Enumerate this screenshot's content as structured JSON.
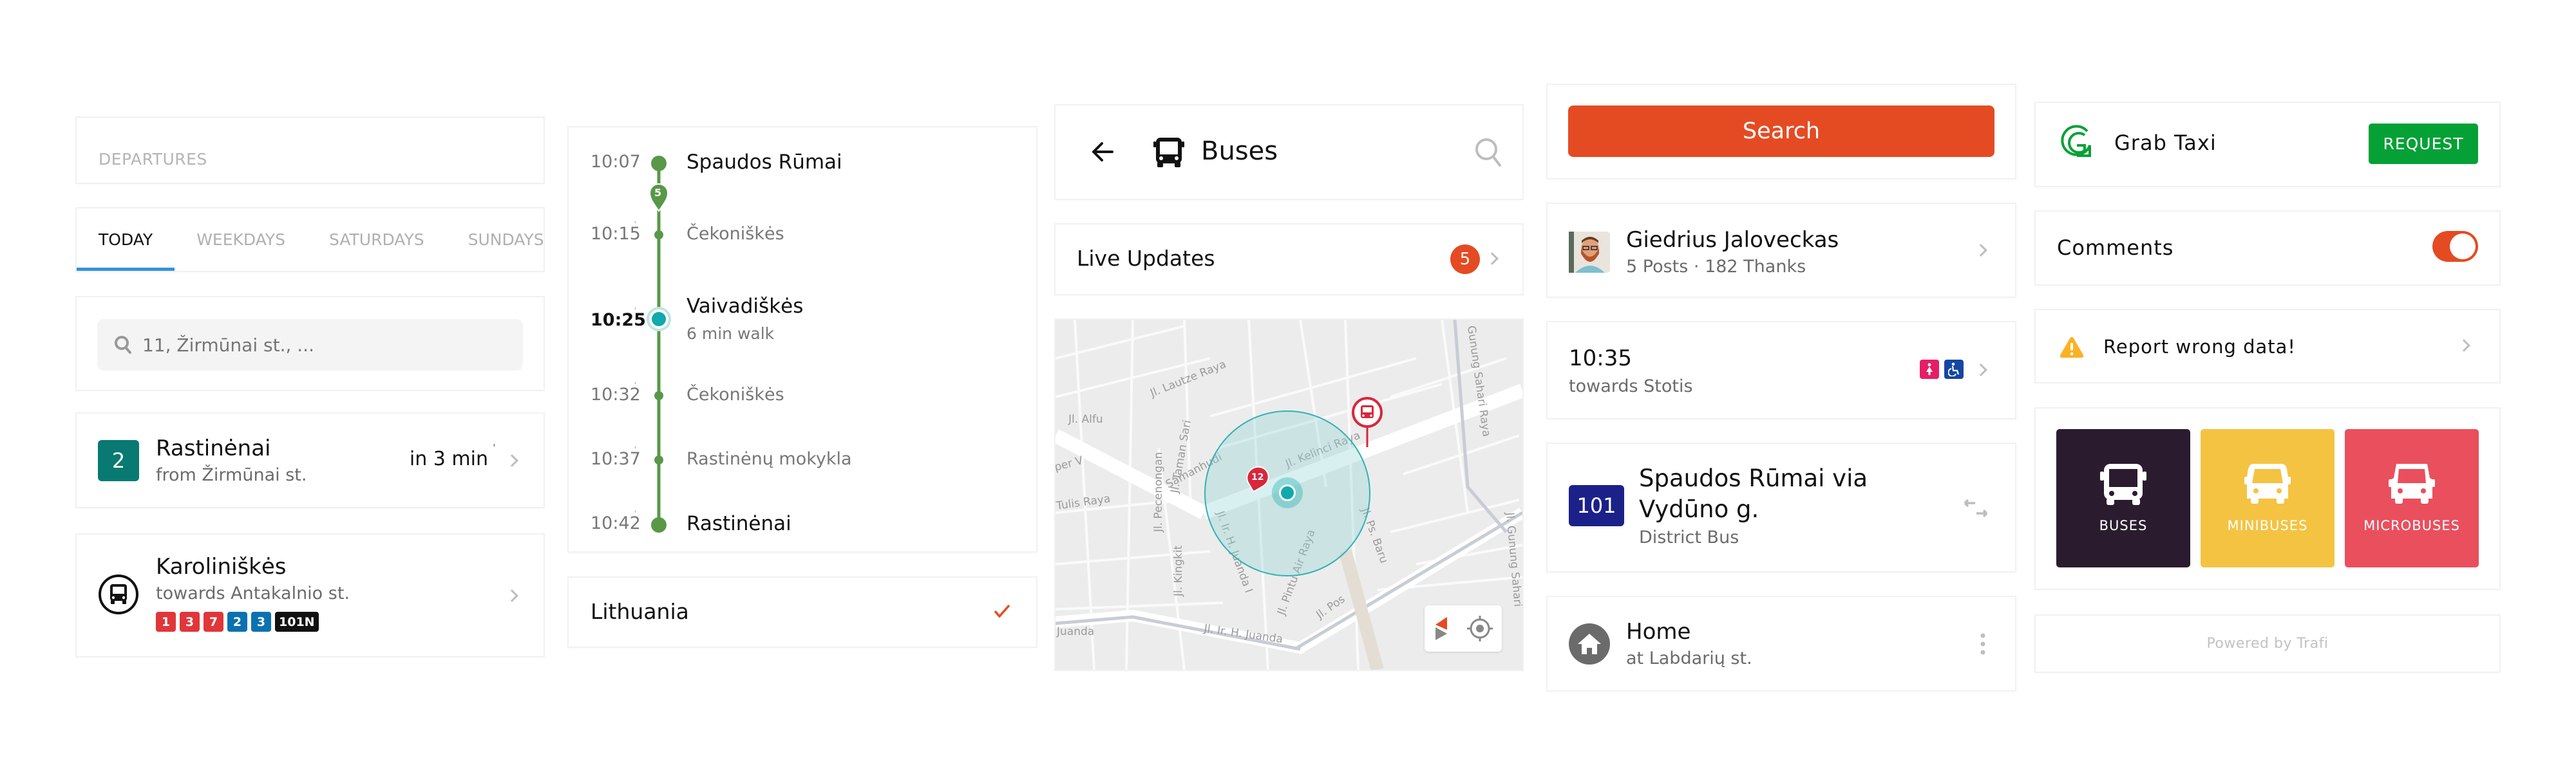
{
  "departures": {
    "header_label": "DEPARTURES",
    "tabs": [
      {
        "label": "TODAY",
        "active": true
      },
      {
        "label": "WEEKDAYS",
        "active": false
      },
      {
        "label": "SATURDAYS",
        "active": false
      },
      {
        "label": "SUNDAYS",
        "active": false
      }
    ],
    "search": {
      "placeholder": "11, Žirmūnai st., ..."
    },
    "next_departure": {
      "route_number": "2",
      "route_color": "#087a72",
      "destination": "Rastinėnai",
      "origin": "from Žirmūnai st.",
      "eta": "in 3 min"
    },
    "stop": {
      "name": "Karoliniškės",
      "direction": "towards Antakalnio st.",
      "routes": [
        {
          "label": "1",
          "color": "#e0363a"
        },
        {
          "label": "3",
          "color": "#e0363a"
        },
        {
          "label": "7",
          "color": "#e0363a"
        },
        {
          "label": "2",
          "color": "#0b72b0"
        },
        {
          "label": "3",
          "color": "#0b72b0"
        },
        {
          "label": "101N",
          "color": "#111111"
        }
      ]
    }
  },
  "timeline": {
    "line_color": "#589848",
    "route_marker": "5",
    "stops": [
      {
        "time": "10:07",
        "name": "Spaudos Rūmai",
        "type": "major",
        "realtime": false
      },
      {
        "time": "10:15",
        "name": "Čekoniškės",
        "type": "minor",
        "realtime": true
      },
      {
        "time": "10:25",
        "name": "Vaivadiškės",
        "type": "current",
        "realtime": true,
        "note": "6 min walk"
      },
      {
        "time": "10:32",
        "name": "Čekoniškės",
        "type": "minor",
        "realtime": true
      },
      {
        "time": "10:37",
        "name": "Rastinėnų mokykla",
        "type": "minor",
        "realtime": true
      },
      {
        "time": "10:42",
        "name": "Rastinėnai",
        "type": "major",
        "realtime": true
      }
    ]
  },
  "country": {
    "name": "Lithuania",
    "selected": true
  },
  "buses_header": {
    "title": "Buses"
  },
  "live_updates": {
    "label": "Live Updates",
    "count": "5"
  },
  "map": {
    "street_labels": [
      "Jl. Lautze Raya",
      "Jl. Alfu",
      "Jl. Taman Sari",
      "Samanhudi",
      "Jl. Kelinci Raya",
      "Gunung Sahari Raya",
      "Jl. Gunung Sahari",
      "Jl. Pecenongan",
      "Jl. Kingkit",
      "Jl. Ir. H. Juanda I",
      "Jl. Pintu Air Raya",
      "Jl. Ps. Baru",
      "Jl. Pos",
      "Jl. Ir. H. Juanda",
      "Juanda",
      "Tulis Raya",
      "per V"
    ],
    "vehicle_marker": "12"
  },
  "search_button": {
    "label": "Search"
  },
  "profile": {
    "name": "Giedrius Jaloveckas",
    "stats": "5 Posts · 182 Thanks"
  },
  "departure_item": {
    "time": "10:35",
    "direction": "towards Stotis",
    "amenities": [
      "female-icon",
      "wheelchair-icon"
    ]
  },
  "route_item": {
    "number": "101",
    "color": "#1b2189",
    "title_line1": "Spaudos Rūmai via",
    "title_line2": "Vydūno g.",
    "type": "District Bus"
  },
  "place": {
    "name": "Home",
    "address": "at Labdarių st."
  },
  "taxi": {
    "name": "Grab Taxi",
    "button": "REQUEST",
    "brand_color": "#05a136"
  },
  "comments": {
    "label": "Comments",
    "enabled": true
  },
  "report": {
    "label": "Report wrong data!"
  },
  "vehicle_types": [
    {
      "label": "BUSES",
      "color": "#2a1c2e"
    },
    {
      "label": "MINIBUSES",
      "color": "#f4c342"
    },
    {
      "label": "MICROBUSES",
      "color": "#ea4f5d"
    }
  ],
  "footer": {
    "powered_by": "Powered by Trafi"
  },
  "colors": {
    "accent": "#e44b23",
    "tab_indicator": "#3592de",
    "current_stop": "#10a9ac"
  }
}
